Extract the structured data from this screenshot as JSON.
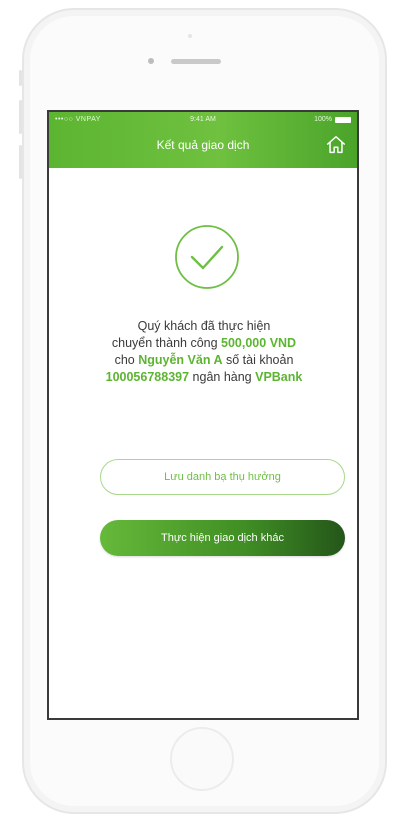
{
  "status_bar": {
    "carrier": "•••○○ VNPAY",
    "time": "9:41 AM",
    "battery": "100%"
  },
  "header": {
    "title": "Kết quả giao dịch"
  },
  "message": {
    "line1": "Quý khách đã thực hiện",
    "line2_prefix": "chuyển thành công ",
    "amount": "500,000 VND",
    "line3_prefix": "cho ",
    "recipient": "Nguyễn Văn A",
    "line3_suffix": " số tài khoản",
    "account_number": "100056788397",
    "line4_middle": " ngân hàng ",
    "bank": "VPBank"
  },
  "buttons": {
    "save_beneficiary": "Lưu danh bạ thụ hưởng",
    "new_transaction": "Thực hiện giao dịch khác"
  },
  "colors": {
    "brand_green": "#5cb531",
    "dark_green": "#24561a"
  },
  "icons": {
    "home": "home-icon",
    "success": "check-circle-icon"
  }
}
